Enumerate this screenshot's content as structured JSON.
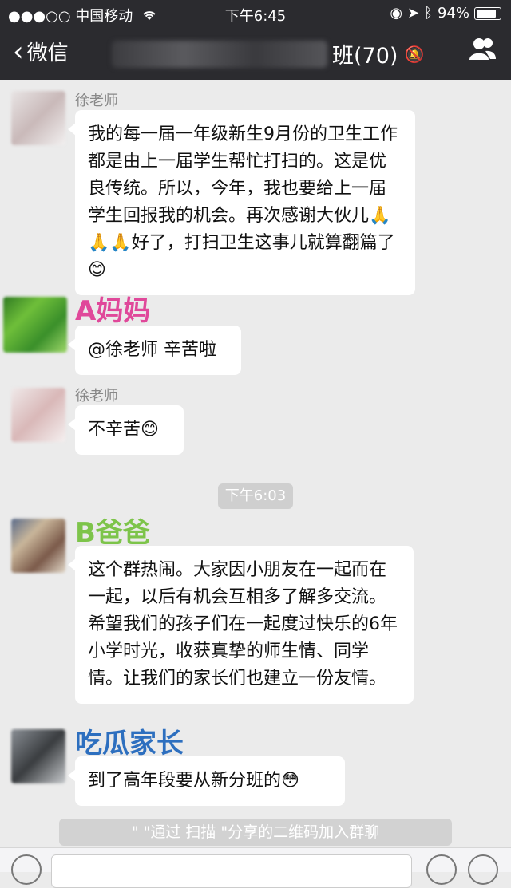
{
  "status_bar": {
    "signal": "●●●○○",
    "carrier": "中国移动",
    "time": "下午6:45",
    "battery": "94%",
    "battery_fraction": 0.94
  },
  "nav": {
    "back_label": "微信",
    "title_suffix": "班(70)"
  },
  "messages": [
    {
      "sender": "徐老师",
      "text": "我的每一届一年级新生9月份的卫生工作都是由上一届学生帮忙打扫的。这是优良传统。所以，今年，我也要给上一届学生回报我的机会。再次感谢大伙儿🙏🙏🙏好了，打扫卫生这事儿就算翻篇了😊"
    },
    {
      "sender": "A妈妈",
      "sender_color": "#e0489a",
      "text": "@徐老师 辛苦啦"
    },
    {
      "sender": "徐老师",
      "text": "不辛苦😊"
    },
    {
      "sender": "B爸爸",
      "sender_color": "#7dc44a",
      "text": "这个群热闹。大家因小朋友在一起而在一起，以后有机会互相多了解多交流。希望我们的孩子们在一起度过快乐的6年小学时光，收获真挚的师生情、同学情。让我们的家长们也建立一份友情。"
    },
    {
      "sender": "吃瓜家长",
      "sender_color": "#2d6fbf",
      "text": "到了高年段要从新分班的😳"
    }
  ],
  "time_chip": "下午6:03",
  "system_note": "\"    \"通过    扫描    \"分享的二维码加入群聊"
}
